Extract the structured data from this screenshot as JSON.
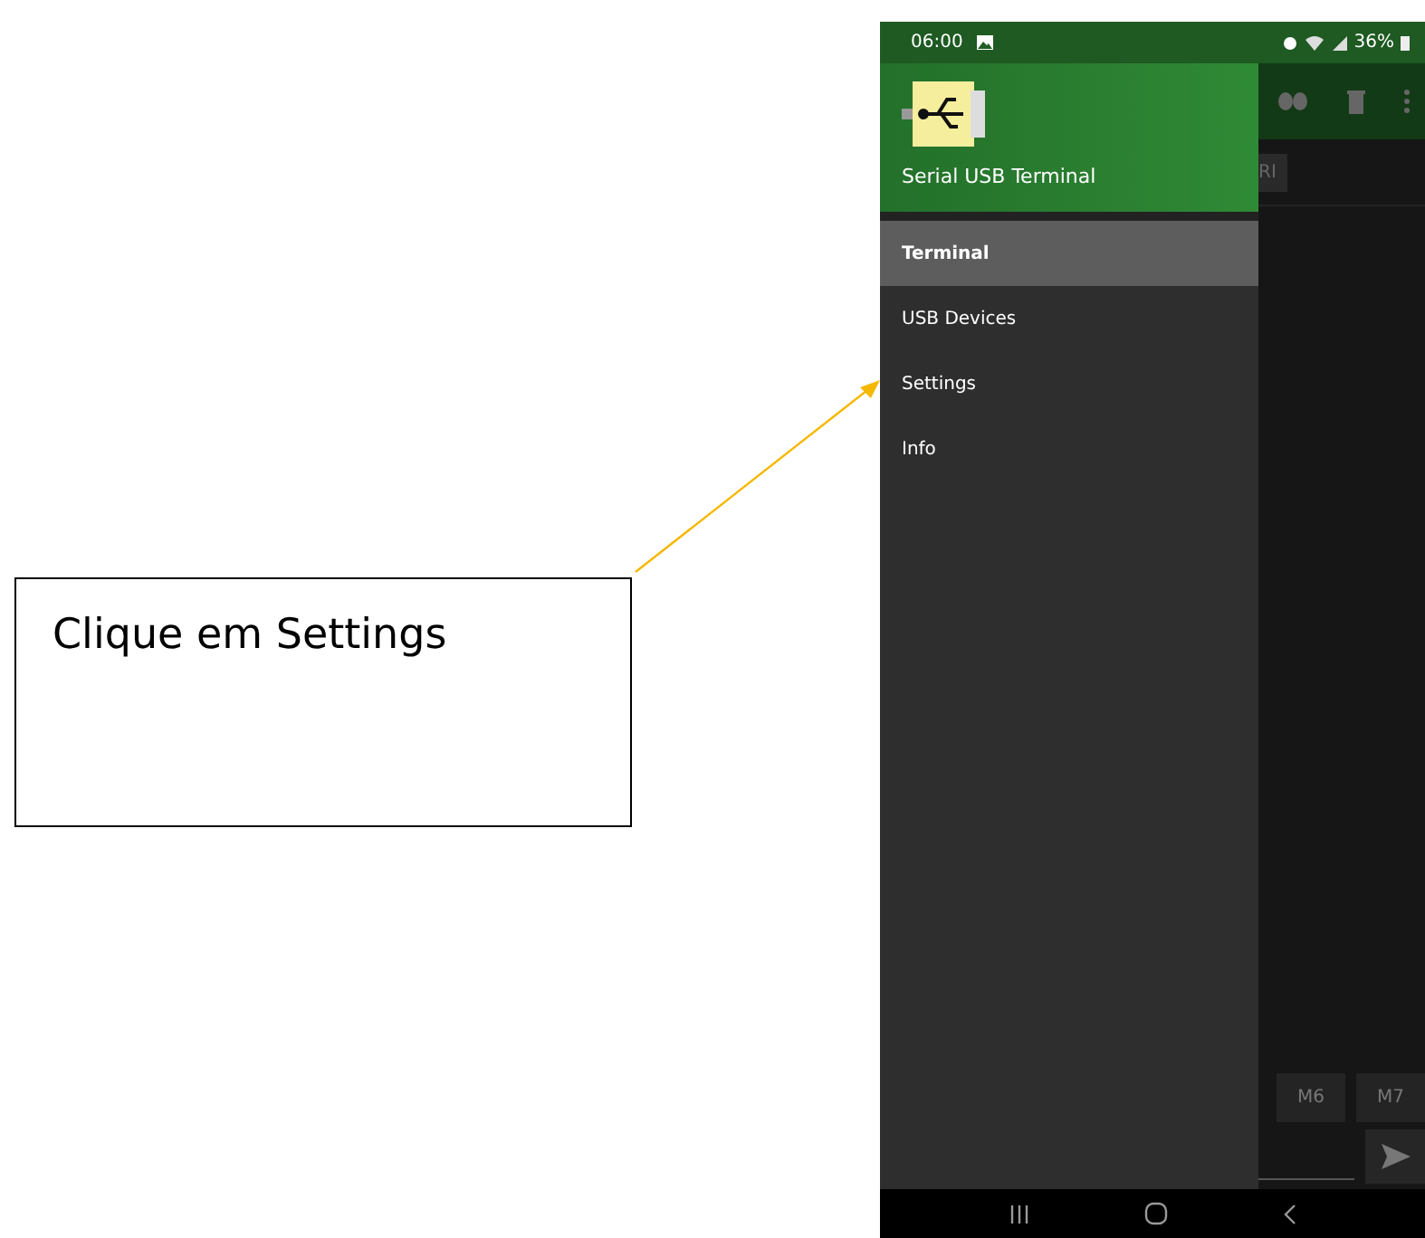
{
  "callout": {
    "text": "Clique em Settings"
  },
  "status_bar": {
    "time": "06:00",
    "battery": "36%"
  },
  "drawer": {
    "title": "Serial USB Terminal",
    "items": [
      {
        "label": "Terminal",
        "selected": true
      },
      {
        "label": "USB Devices",
        "selected": false
      },
      {
        "label": "Settings",
        "selected": false
      },
      {
        "label": "Info",
        "selected": false
      }
    ]
  },
  "background_app": {
    "tab": "RI",
    "macro_buttons": [
      "M6",
      "M7"
    ]
  }
}
